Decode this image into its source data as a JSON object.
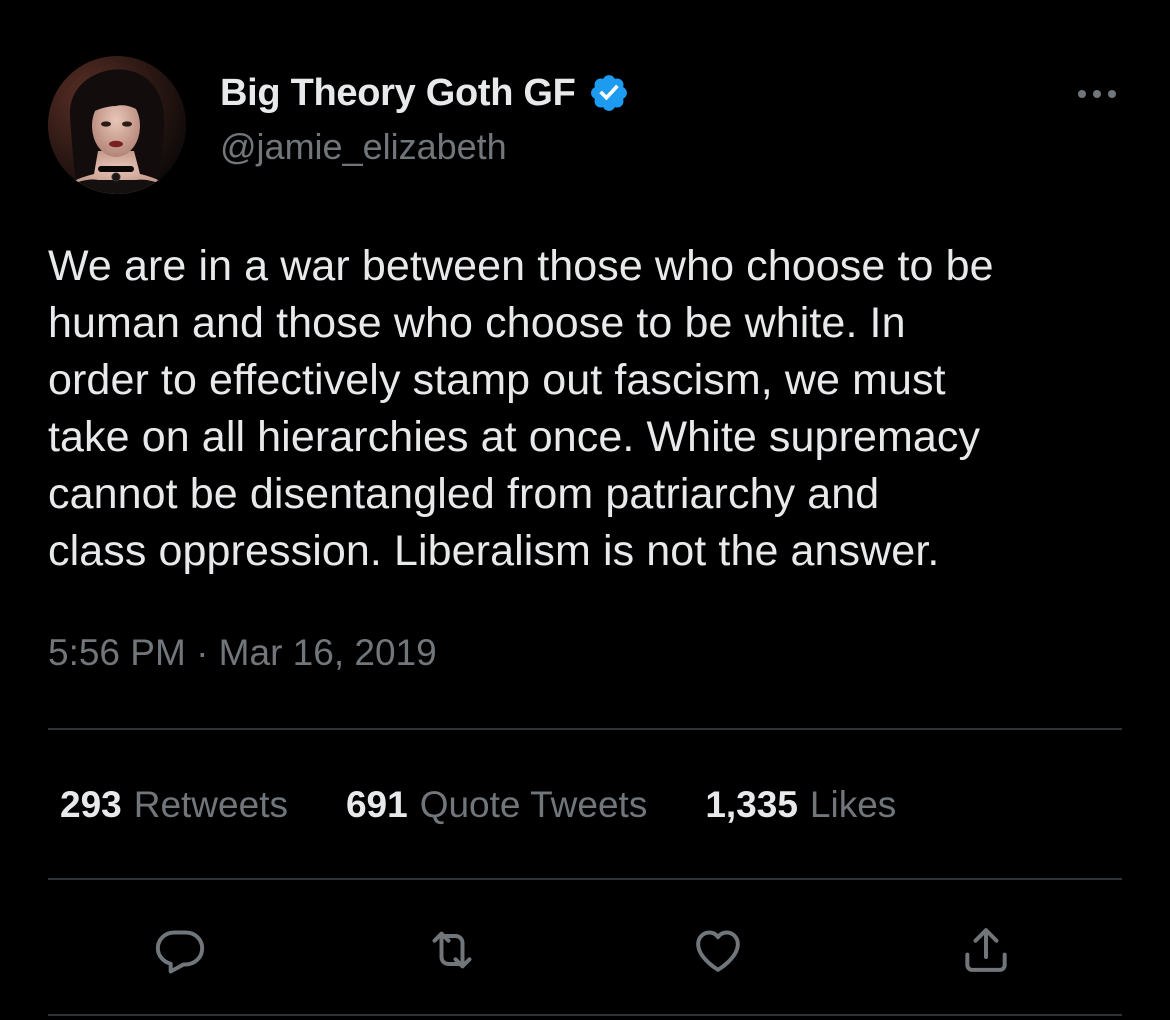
{
  "tweet": {
    "author": {
      "display_name": "Big Theory Goth GF",
      "handle": "@jamie_elizabeth",
      "verified": true,
      "avatar_icon": "profile-photo"
    },
    "more_icon": "ellipsis-icon",
    "text": "We are in a war between those who choose to be\nhuman and those who choose to be white. In\norder to effectively stamp out fascism, we must\ntake on all hierarchies at once. White supremacy\ncannot be disentangled from patriarchy and\nclass oppression. Liberalism is not the answer.",
    "timestamp": "5:56 PM · Mar 16, 2019",
    "stats": {
      "retweets_count": "293",
      "retweets_label": "Retweets",
      "quotes_count": "691",
      "quotes_label": "Quote Tweets",
      "likes_count": "1,335",
      "likes_label": "Likes"
    },
    "actions": [
      "reply-icon",
      "retweet-icon",
      "like-icon",
      "share-icon"
    ]
  },
  "colors": {
    "background": "#000000",
    "primary_text": "#e7e9ea",
    "secondary_text": "#71767b",
    "divider": "#2f3336",
    "verified_blue": "#1d9bf0"
  }
}
